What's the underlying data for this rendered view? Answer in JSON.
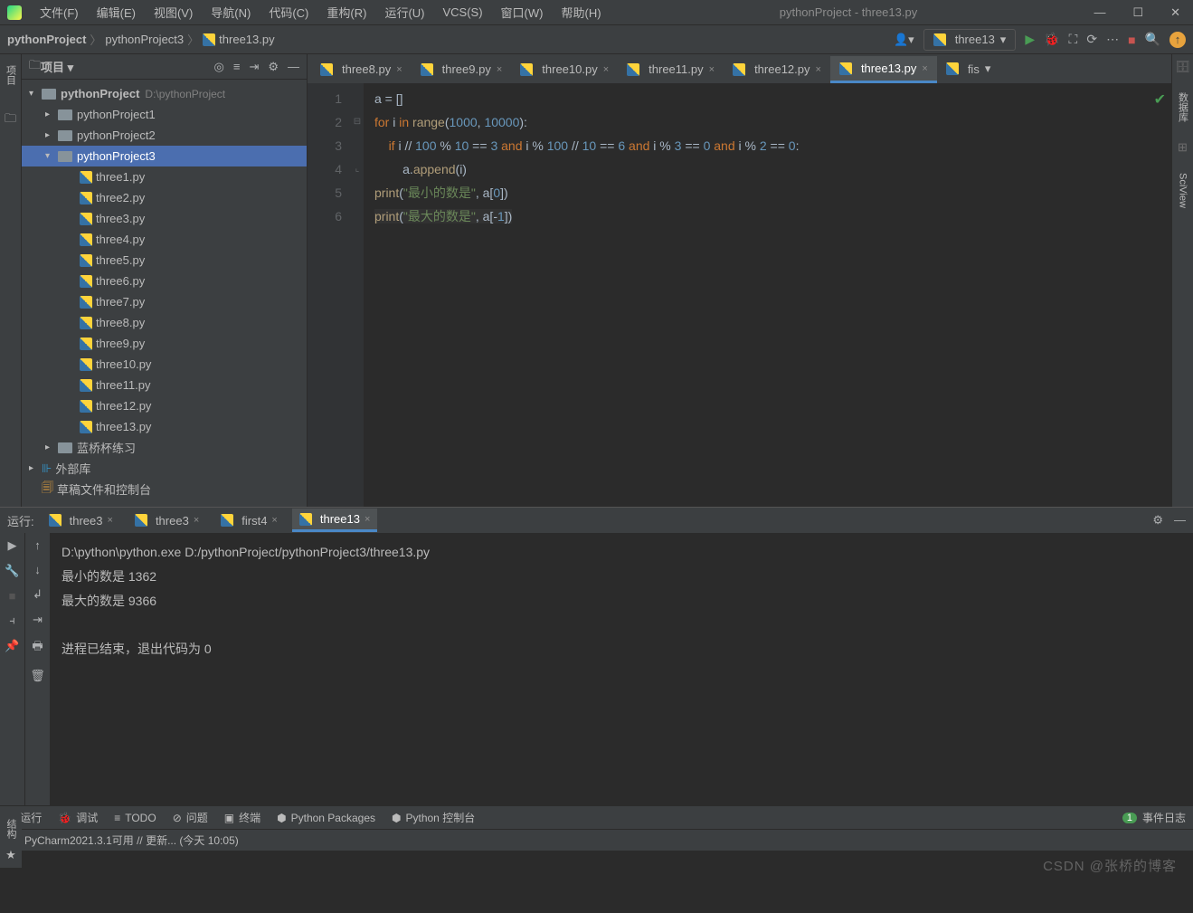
{
  "title": "pythonProject - three13.py",
  "menus": [
    "文件(F)",
    "编辑(E)",
    "视图(V)",
    "导航(N)",
    "代码(C)",
    "重构(R)",
    "运行(U)",
    "VCS(S)",
    "窗口(W)",
    "帮助(H)"
  ],
  "breadcrumb": {
    "p1": "pythonProject",
    "p2": "pythonProject3",
    "p3": "three13.py"
  },
  "runConfig": "three13",
  "project": {
    "header": "项目",
    "root": {
      "name": "pythonProject",
      "path": "D:\\pythonProject"
    },
    "sub1": "pythonProject1",
    "sub2": "pythonProject2",
    "sub3": "pythonProject3",
    "files": [
      "three1.py",
      "three2.py",
      "three3.py",
      "three4.py",
      "three5.py",
      "three6.py",
      "three7.py",
      "three8.py",
      "three9.py",
      "three10.py",
      "three11.py",
      "three12.py",
      "three13.py"
    ],
    "lanqiao": "蓝桥杯练习",
    "extlib": "外部库",
    "scratch": "草稿文件和控制台"
  },
  "editorTabs": [
    "three8.py",
    "three9.py",
    "three10.py",
    "three11.py",
    "three12.py",
    "three13.py",
    "fis"
  ],
  "code": {
    "l1": {
      "a": "a = []"
    },
    "l2": {
      "for": "for",
      "i": " i ",
      "in": "in",
      "sp": " ",
      "range": "range",
      "op": "(",
      "n1": "1000",
      "c": ", ",
      "n2": "10000",
      "cp": "):"
    },
    "l3": {
      "pad": "    ",
      "if": "if",
      "s1": " i // ",
      "n100": "100",
      "s2": " % ",
      "n10": "10",
      "s3": " == ",
      "n3": "3",
      "and1": " and ",
      "s4": "i % ",
      "s5": " // ",
      "s6": " == ",
      "n6": "6",
      "and2": " and ",
      "s7": "i % ",
      "nn3": "3",
      "s8": " == ",
      "n0": "0",
      "and3": " and ",
      "s9": "i % ",
      "n2": "2",
      "s10": " == ",
      "n0b": "0",
      "col": ":"
    },
    "l4": {
      "pad": "        ",
      "a": "a.",
      "append": "append",
      "r": "(i)"
    },
    "l5": {
      "print": "print",
      "op": "(",
      "str": "\"最小的数是\"",
      "c": ", a[",
      "z": "0",
      "cp": "])"
    },
    "l6": {
      "print": "print",
      "op": "(",
      "str": "\"最大的数是\"",
      "c": ", a[-",
      "z": "1",
      "cp": "])"
    }
  },
  "runPanel": {
    "label": "运行:",
    "tabs": [
      "three3",
      "three3",
      "first4",
      "three13"
    ],
    "console": {
      "cmd": "D:\\python\\python.exe D:/pythonProject/pythonProject3/three13.py",
      "out1": "最小的数是 1362",
      "out2": "最大的数是 9366",
      "exit": "进程已结束，退出代码为 0"
    }
  },
  "toolStrip": {
    "run": "运行",
    "debug": "调试",
    "todo": "TODO",
    "problems": "问题",
    "terminal": "终端",
    "pypkg": "Python Packages",
    "pyconsole": "Python 控制台",
    "events": "事件日志",
    "badge": "1"
  },
  "sideLabels": {
    "project": "项目",
    "database": "数据库",
    "sciview": "SciView",
    "structure": "结构",
    "favorites": "收藏"
  },
  "status": {
    "text": "PyCharm2021.3.1可用 // 更新... (今天 10:05)"
  },
  "watermark": "CSDN @张桥的博客"
}
